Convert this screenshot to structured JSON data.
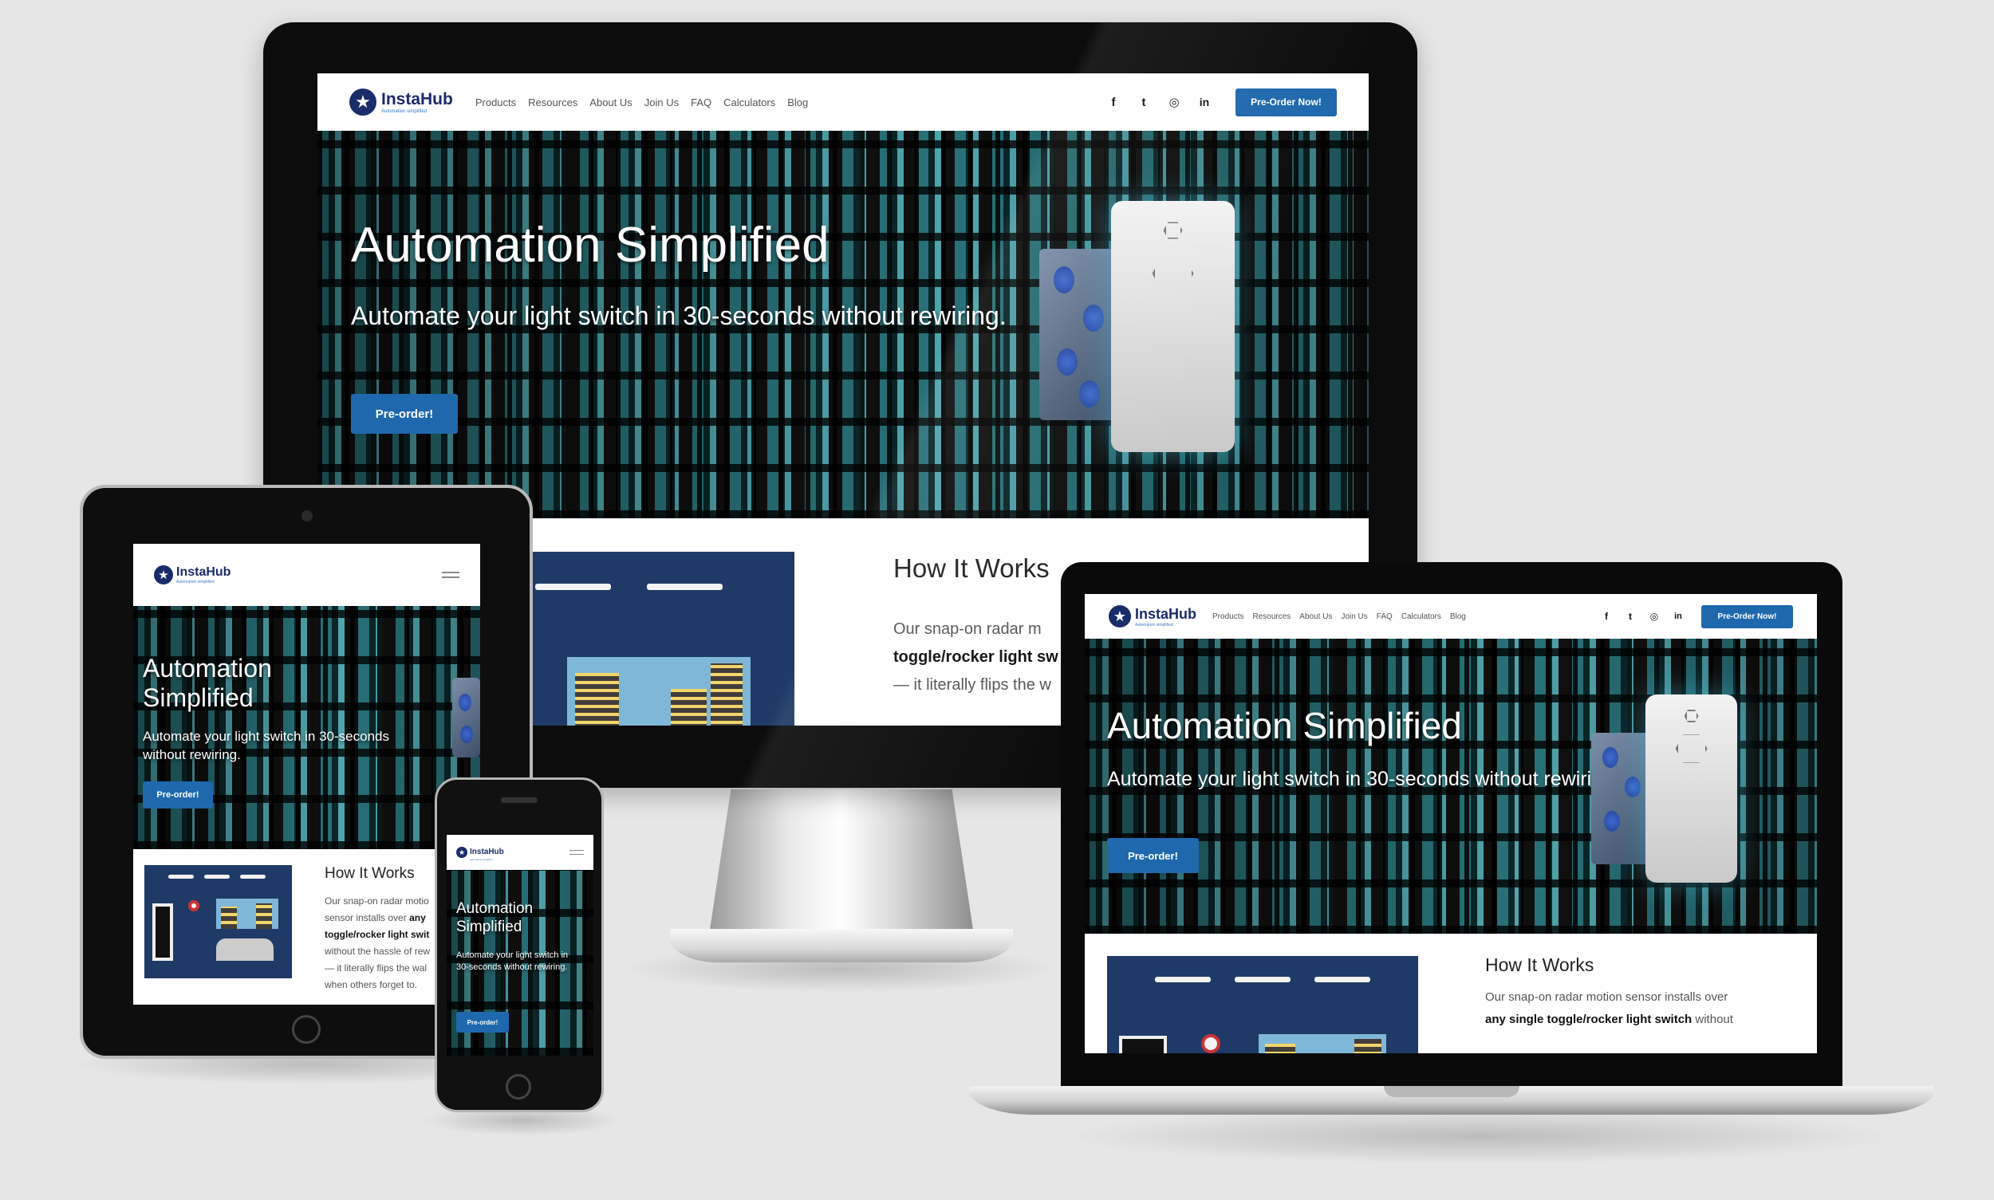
{
  "site": {
    "brand": "InstaHub",
    "tagline": "Automation simplified",
    "nav": [
      "Products",
      "Resources",
      "About Us",
      "Join Us",
      "FAQ",
      "Calculators",
      "Blog"
    ],
    "social_icons": [
      "facebook-icon",
      "twitter-icon",
      "instagram-icon",
      "linkedin-icon"
    ],
    "social_glyphs": {
      "facebook": "f",
      "twitter": "t",
      "instagram": "◎",
      "linkedin": "in"
    },
    "cta": "Pre-Order Now!",
    "colors": {
      "brand_navy": "#1b2c6b",
      "button_blue": "#1f68ad",
      "illustration_navy": "#1f3a66"
    }
  },
  "hero": {
    "title": "Automation Simplified",
    "title_line1": "Automation",
    "title_line2": "Simplified",
    "subtitle": "Automate your light switch in 30-seconds without rewiring.",
    "tablet_subtitle": "Automate your light switch in 30-seconds without rewiring.",
    "phone_subtitle": "Automate your light switch in 30-seconds without rewiring.",
    "button": "Pre-order!"
  },
  "how_it_works": {
    "heading": "How It Works",
    "desktop_text_start": "Our snap-on radar m",
    "desktop_bold": "toggle/rocker light sw",
    "desktop_text_end": "— it literally flips the w",
    "laptop_text_start": "Our snap-on radar motion sensor installs over",
    "laptop_bold": "any single toggle/rocker light switch",
    "laptop_text_end": "without",
    "tablet_text_1": "Our snap-on radar motio",
    "tablet_text_2": "sensor installs over",
    "tablet_bold_1": "any",
    "tablet_bold_2": "toggle/rocker light swit",
    "tablet_text_3": "without the hassle of rew",
    "tablet_text_4": "— it literally flips the wal",
    "tablet_text_5": "when others forget to."
  }
}
